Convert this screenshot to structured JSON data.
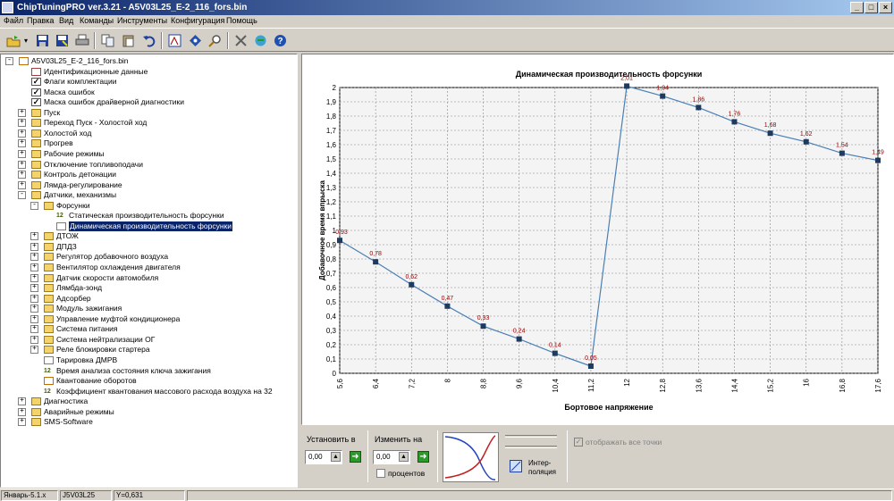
{
  "window": {
    "title": "ChipTuningPRO ver.3.21 - A5V03L25_E-2_116_fors.bin",
    "min": "_",
    "max": "□",
    "close": "×"
  },
  "menu": [
    "Файл",
    "Правка",
    "Вид",
    "Команды",
    "Инструменты",
    "Конфигурация",
    "Помощь"
  ],
  "toolbar": {
    "icons": [
      "open-icon",
      "dropdown-arrow-icon",
      "save-icon",
      "save-as-icon",
      "print-icon",
      "copy-icon",
      "paste-icon",
      "undo-icon",
      "calibration-icon",
      "checksum-icon",
      "search-icon",
      "tools-icon",
      "update-icon",
      "help-icon"
    ]
  },
  "tree": [
    {
      "label": "A5V03L25_E-2_116_fors.bin",
      "level": 0,
      "icon": "file",
      "exp": "-"
    },
    {
      "label": "Идентификационные данные",
      "level": 1,
      "icon": "ident",
      "exp": ""
    },
    {
      "label": "Флаги комплектации",
      "level": 1,
      "icon": "check",
      "exp": ""
    },
    {
      "label": "Маска ошибок",
      "level": 1,
      "icon": "check",
      "exp": ""
    },
    {
      "label": "Маска ошибок драйверной диагностики",
      "level": 1,
      "icon": "check",
      "exp": ""
    },
    {
      "label": "Пуск",
      "level": 1,
      "icon": "folder",
      "exp": "+"
    },
    {
      "label": "Переход Пуск - Холостой ход",
      "level": 1,
      "icon": "folder",
      "exp": "+"
    },
    {
      "label": "Холостой ход",
      "level": 1,
      "icon": "folder",
      "exp": "+"
    },
    {
      "label": "Прогрев",
      "level": 1,
      "icon": "folder",
      "exp": "+"
    },
    {
      "label": "Рабочие режимы",
      "level": 1,
      "icon": "folder",
      "exp": "+"
    },
    {
      "label": "Отключение топливоподачи",
      "level": 1,
      "icon": "folder",
      "exp": "+"
    },
    {
      "label": "Контроль детонации",
      "level": 1,
      "icon": "folder",
      "exp": "+"
    },
    {
      "label": "Лямда-регулирование",
      "level": 1,
      "icon": "folder",
      "exp": "+"
    },
    {
      "label": "Датчики, механизмы",
      "level": 1,
      "icon": "folder",
      "exp": "-"
    },
    {
      "label": "Форсунки",
      "level": 2,
      "icon": "folder",
      "exp": "-"
    },
    {
      "label": "Статическая производительность форсунки",
      "level": 3,
      "icon": "num",
      "exp": ""
    },
    {
      "label": "Динамическая производительность форсунки",
      "level": 3,
      "icon": "table",
      "exp": "",
      "selected": true
    },
    {
      "label": "ДТОЖ",
      "level": 2,
      "icon": "folder",
      "exp": "+"
    },
    {
      "label": "ДПДЗ",
      "level": 2,
      "icon": "folder",
      "exp": "+"
    },
    {
      "label": "Регулятор добавочного воздуха",
      "level": 2,
      "icon": "folder",
      "exp": "+"
    },
    {
      "label": "Вентилятор охлаждения двигателя",
      "level": 2,
      "icon": "folder",
      "exp": "+"
    },
    {
      "label": "Датчик скорости автомобиля",
      "level": 2,
      "icon": "folder",
      "exp": "+"
    },
    {
      "label": "Лямбда-зонд",
      "level": 2,
      "icon": "folder",
      "exp": "+"
    },
    {
      "label": "Адсорбер",
      "level": 2,
      "icon": "folder",
      "exp": "+"
    },
    {
      "label": "Модуль зажигания",
      "level": 2,
      "icon": "folder",
      "exp": "+"
    },
    {
      "label": "Управление муфтой кондиционера",
      "level": 2,
      "icon": "folder",
      "exp": "+"
    },
    {
      "label": "Система питания",
      "level": 2,
      "icon": "folder",
      "exp": "+"
    },
    {
      "label": "Система нейтрализации ОГ",
      "level": 2,
      "icon": "folder",
      "exp": "+"
    },
    {
      "label": "Реле блокировки стартера",
      "level": 2,
      "icon": "folder",
      "exp": "+"
    },
    {
      "label": "Тарировка ДМРВ",
      "level": 2,
      "icon": "table",
      "exp": ""
    },
    {
      "label": "Время анализа состояния ключа зажигания",
      "level": 2,
      "icon": "num",
      "exp": ""
    },
    {
      "label": "Квантование оборотов",
      "level": 2,
      "icon": "table",
      "exp": ""
    },
    {
      "label": "Коэффициент квантования массового расхода воздуха на 32",
      "level": 2,
      "icon": "num",
      "exp": ""
    },
    {
      "label": "Диагностика",
      "level": 1,
      "icon": "folder",
      "exp": "+"
    },
    {
      "label": "Аварийные режимы",
      "level": 1,
      "icon": "folder",
      "exp": "+"
    },
    {
      "label": "SMS-Software",
      "level": 1,
      "icon": "folder",
      "exp": "+"
    }
  ],
  "chart_data": {
    "type": "line",
    "title": "Динамическая производительность форсунки",
    "xlabel": "Бортовое напряжение",
    "ylabel": "Добавочное время впрыска",
    "x": [
      5.6,
      6.4,
      7.2,
      8,
      8.8,
      9.6,
      10.4,
      11.2,
      12,
      12.8,
      13.6,
      14.4,
      15.2,
      16,
      16.8,
      17.6
    ],
    "x_tick_labels": [
      "5,6",
      "6,4",
      "7,2",
      "8",
      "8,8",
      "9,6",
      "10,4",
      "11,2",
      "12",
      "12,8",
      "13,6",
      "14,4",
      "15,2",
      "16",
      "16,8",
      "17,6"
    ],
    "values": [
      0.93,
      0.78,
      0.62,
      0.47,
      0.33,
      0.24,
      0.14,
      0.05,
      2.01,
      1.94,
      1.86,
      1.76,
      1.68,
      1.62,
      1.54,
      1.49
    ],
    "point_labels": [
      "0,93",
      "0,78",
      "0,62",
      "0,47",
      "0,33",
      "0,24",
      "0,14",
      "0,05",
      "2,01",
      "1,94",
      "1,86",
      "1,76",
      "1,68",
      "1,62",
      "1,54",
      "1,49"
    ],
    "y_tick_labels": [
      "0",
      "0,1",
      "0,2",
      "0,3",
      "0,4",
      "0,5",
      "0,6",
      "0,7",
      "0,8",
      "0,9",
      "1",
      "1,1",
      "1,2",
      "1,3",
      "1,4",
      "1,5",
      "1,6",
      "1,7",
      "1,8",
      "1,9",
      "2"
    ],
    "ylim": [
      0,
      2
    ],
    "xlim": [
      5.6,
      17.6
    ],
    "grid": true,
    "line_color": "#4a7fb5",
    "marker_color": "#1f3a5f",
    "label_color": "#a00000"
  },
  "controls": {
    "set_label": "Установить в",
    "set_value": "0,00",
    "change_label": "Изменить на",
    "change_value": "0,00",
    "percent_label": "процентов",
    "interp_label": "Интер-\nполяция",
    "show_all_label": "отображать все точки"
  },
  "status": [
    "Январь-5.1.x",
    "J5V03L25",
    "Y=0,631"
  ]
}
